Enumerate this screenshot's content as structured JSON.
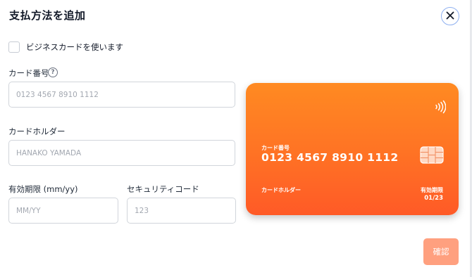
{
  "dialog": {
    "title": "支払方法を追加",
    "close_icon": "close-icon"
  },
  "business_card": {
    "label": "ビジネスカードを使います",
    "checked": false
  },
  "form": {
    "card_number": {
      "label": "カード番号",
      "placeholder": "0123 4567 8910 1112",
      "help_icon": "help-icon"
    },
    "card_holder": {
      "label": "カードホルダー",
      "placeholder": "HANAKO YAMADA"
    },
    "expiry": {
      "label": "有効期限 (mm/yy)",
      "placeholder": "MM/YY"
    },
    "security_code": {
      "label": "セキュリティコード",
      "placeholder": "123"
    }
  },
  "card_preview": {
    "number_label": "カード番号",
    "number": "0123 4567 8910 1112",
    "holder_label": "カードホルダー",
    "expiry_label": "有効期限",
    "expiry": "01/23",
    "colors": {
      "gradient_top": "#ff8a22",
      "gradient_bottom": "#ff5a27"
    },
    "icons": [
      "contactless-icon",
      "chip-icon"
    ]
  },
  "actions": {
    "confirm_label": "確認",
    "confirm_color": "#ffa07f"
  }
}
